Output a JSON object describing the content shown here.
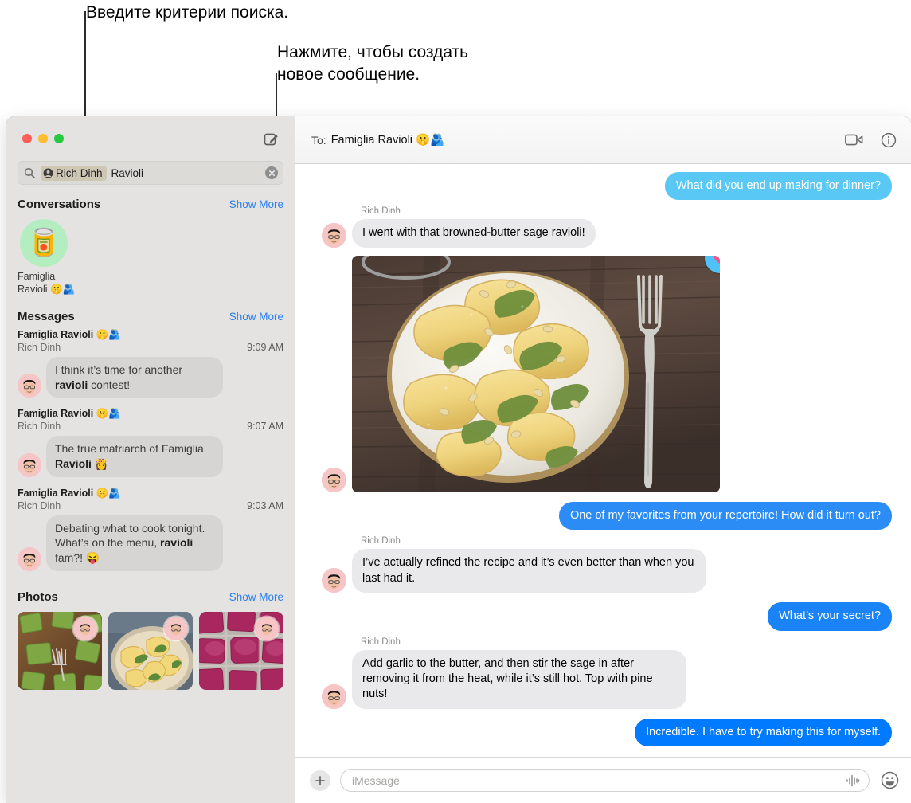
{
  "callouts": {
    "search_hint": "Введите критерии поиска.",
    "compose_hint_line1": "Нажмите, чтобы создать",
    "compose_hint_line2": "новое сообщение."
  },
  "window": {
    "traffic_lights": {
      "close_color": "#ff5f57",
      "minimize_color": "#febc2e",
      "zoom_color": "#28c840"
    },
    "compose_icon": "compose-square-pencil-icon"
  },
  "search": {
    "magnifier_icon": "search-icon",
    "token_icon": "person-circle-icon",
    "token_label": "Rich Dinh",
    "query_text": "Ravioli",
    "clear_icon": "clear-circle-x-icon"
  },
  "sidebar": {
    "sections": [
      {
        "title": "Conversations",
        "show_more": "Show More"
      },
      {
        "title": "Messages",
        "show_more": "Show More"
      },
      {
        "title": "Photos",
        "show_more": "Show More"
      }
    ],
    "conversation_results": [
      {
        "avatar_emoji": "🥫",
        "avatar_bg": "#b4eec0",
        "name": "Famiglia Ravioli 🤫🫂"
      }
    ],
    "message_results": [
      {
        "group": "Famiglia Ravioli 🤫🫂",
        "sender": "Rich Dinh",
        "time": "9:09 AM",
        "text_before": "I think it’s time for another ",
        "highlight": "ravioli",
        "text_after": " contest!"
      },
      {
        "group": "Famiglia Ravioli 🤫🫂",
        "sender": "Rich Dinh",
        "time": "9:07 AM",
        "text_before": "The true matriarch of Famiglia ",
        "highlight": "Ravioli",
        "text_after": " 👸"
      },
      {
        "group": "Famiglia Ravioli 🤫🫂",
        "sender": "Rich Dinh",
        "time": "9:03 AM",
        "text_before": "Debating what to cook tonight. What’s on the menu, ",
        "highlight": "ravioli",
        "text_after": " fam?! 😝"
      }
    ],
    "photo_results": [
      {
        "alt": "green-spinach-ravioli-on-wood-board"
      },
      {
        "alt": "yellow-ravioli-with-sage-in-bowl"
      },
      {
        "alt": "pink-beet-ravioli-rows"
      }
    ]
  },
  "conversation": {
    "to_label": "To:",
    "recipient": "Famiglia Ravioli 🤫🫂",
    "facetime_icon": "video-camera-icon",
    "info_icon": "info-circle-icon",
    "messages": [
      {
        "direction": "out",
        "text": "What did you end up making for dinner?",
        "bubble_color": "#5ac8f5"
      },
      {
        "direction": "in",
        "sender": "Rich Dinh",
        "text": "I went with that browned-butter sage ravioli!"
      },
      {
        "direction": "in",
        "type": "photo",
        "alt": "ravioli-with-sage-on-white-plate-wooden-table",
        "tapback": {
          "icon": "heart-icon",
          "badge_color": "#4fc3f7",
          "heart_color": "#ff4f8b"
        }
      },
      {
        "direction": "out",
        "text": "One of my favorites from your repertoire! How did it turn out?",
        "bubble_color": "#2b8cf5"
      },
      {
        "direction": "in",
        "sender": "Rich Dinh",
        "text": "I’ve actually refined the recipe and it’s even better than when you last had it."
      },
      {
        "direction": "out",
        "text": "What’s your secret?",
        "bubble_color": "#1a84f7"
      },
      {
        "direction": "in",
        "sender": "Rich Dinh",
        "text": "Add garlic to the butter, and then stir the sage in after removing it from the heat, while it’s still hot. Top with pine nuts!"
      },
      {
        "direction": "out",
        "text": "Incredible. I have to try making this for myself.",
        "bubble_color": "#007aff"
      }
    ]
  },
  "composer": {
    "add_icon": "plus-icon",
    "placeholder": "iMessage",
    "audio_icon": "audio-waveform-icon",
    "emoji_icon": "smiley-face-icon"
  }
}
